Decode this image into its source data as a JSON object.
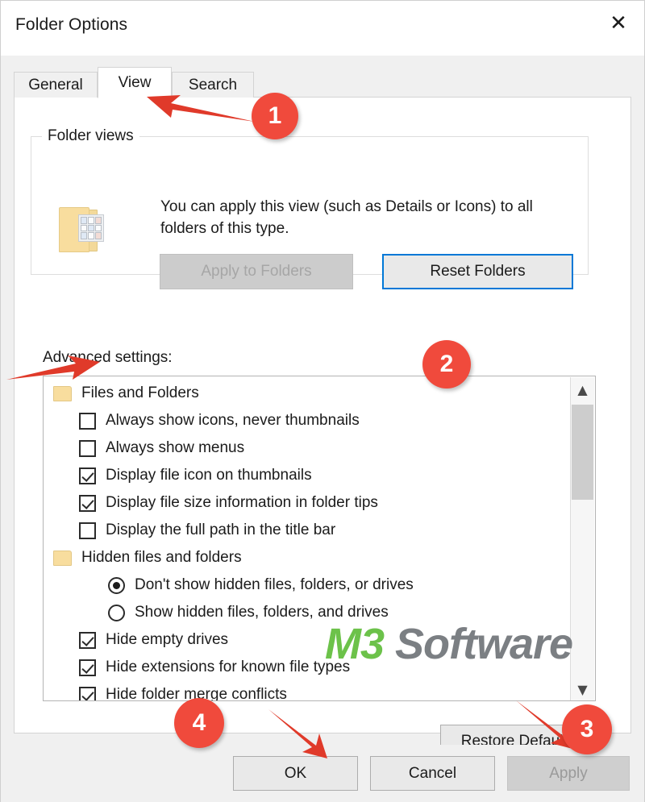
{
  "window": {
    "title": "Folder Options",
    "close_icon": "close-icon"
  },
  "tabs": [
    {
      "label": "General",
      "active": false
    },
    {
      "label": "View",
      "active": true
    },
    {
      "label": "Search",
      "active": false
    }
  ],
  "folder_views": {
    "legend": "Folder views",
    "icon": "folder-views-icon",
    "description": "You can apply this view (such as Details or Icons) to all folders of this type.",
    "apply_to_folders_label": "Apply to Folders",
    "apply_to_folders_enabled": false,
    "reset_folders_label": "Reset Folders",
    "reset_folders_focused": true
  },
  "advanced": {
    "label": "Advanced settings:",
    "rows": [
      {
        "type": "group",
        "label": "Files and Folders"
      },
      {
        "type": "checkbox",
        "label": "Always show icons, never thumbnails",
        "checked": false
      },
      {
        "type": "checkbox",
        "label": "Always show menus",
        "checked": false
      },
      {
        "type": "checkbox",
        "label": "Display file icon on thumbnails",
        "checked": true
      },
      {
        "type": "checkbox",
        "label": "Display file size information in folder tips",
        "checked": true
      },
      {
        "type": "checkbox",
        "label": "Display the full path in the title bar",
        "checked": false
      },
      {
        "type": "group",
        "label": "Hidden files and folders"
      },
      {
        "type": "radio",
        "label": "Don't show hidden files, folders, or drives",
        "checked": true
      },
      {
        "type": "radio",
        "label": "Show hidden files, folders, and drives",
        "checked": false
      },
      {
        "type": "checkbox",
        "label": "Hide empty drives",
        "checked": true
      },
      {
        "type": "checkbox",
        "label": "Hide extensions for known file types",
        "checked": true
      },
      {
        "type": "checkbox",
        "label": "Hide folder merge conflicts",
        "checked": true
      }
    ],
    "scrollbar": {
      "up_icon": "chevron-up-icon",
      "down_icon": "chevron-down-icon"
    }
  },
  "restore_defaults_label": "Restore Defaults",
  "footer": {
    "ok_label": "OK",
    "cancel_label": "Cancel",
    "apply_label": "Apply",
    "apply_enabled": false
  },
  "watermark": {
    "part1": "M3",
    "part2": " Software",
    "color1": "#6cc24a",
    "color2": "#7b7f83"
  },
  "annotations": {
    "accent_color": "#f04a3c",
    "markers": [
      {
        "label": "1",
        "points_at": "view-tab"
      },
      {
        "label": "2",
        "points_at": "always-show-icons-checkbox"
      },
      {
        "label": "3",
        "points_at": "apply-button"
      },
      {
        "label": "4",
        "points_at": "ok-button"
      }
    ]
  }
}
